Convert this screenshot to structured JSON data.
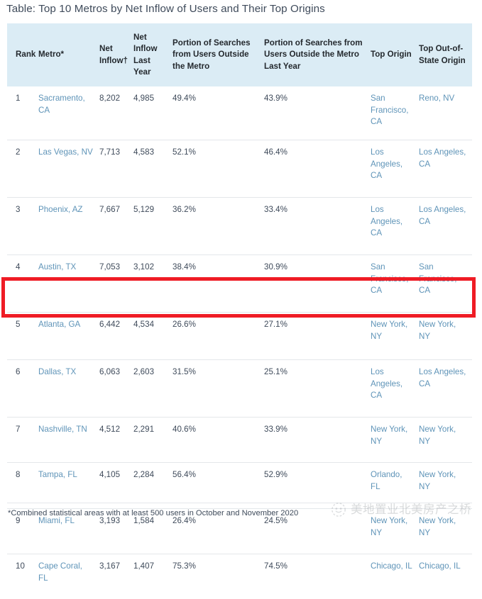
{
  "title": "Table: Top 10 Metros by Net Inflow of Users and Their Top Origins",
  "colors": {
    "header_background": "#dbecf5",
    "link_text": "#5f94b8",
    "body_text": "#3f4b5b",
    "highlight_border": "#ef1c25",
    "row_divider": "#e4e7ea"
  },
  "table": {
    "headers": {
      "rank": "Rank",
      "metro": "Metro*",
      "net_inflow": "Net Inflow†",
      "net_inflow_last_year": "Net Inflow Last Year",
      "portion_outside": "Portion of Searches from Users Outside the Metro",
      "portion_outside_last_year": "Portion of Searches from Users Outside the Metro Last Year",
      "top_origin": "Top Origin",
      "top_out_of_state_origin": "Top Out-of-State Origin"
    },
    "rows": [
      {
        "rank": "1",
        "metro": "Sacramento, CA",
        "net_inflow": "8,202",
        "net_inflow_last_year": "4,985",
        "portion_outside": "49.4%",
        "portion_outside_last_year": "43.9%",
        "top_origin": "San Francisco, CA",
        "top_out_of_state_origin": "Reno, NV"
      },
      {
        "rank": "2",
        "metro": "Las Vegas, NV",
        "net_inflow": "7,713",
        "net_inflow_last_year": "4,583",
        "portion_outside": "52.1%",
        "portion_outside_last_year": "46.4%",
        "top_origin": "Los Angeles, CA",
        "top_out_of_state_origin": "Los Angeles, CA"
      },
      {
        "rank": "3",
        "metro": "Phoenix, AZ",
        "net_inflow": "7,667",
        "net_inflow_last_year": "5,129",
        "portion_outside": "36.2%",
        "portion_outside_last_year": "33.4%",
        "top_origin": "Los Angeles, CA",
        "top_out_of_state_origin": "Los Angeles, CA"
      },
      {
        "rank": "4",
        "metro": "Austin, TX",
        "net_inflow": "7,053",
        "net_inflow_last_year": "3,102",
        "portion_outside": "38.4%",
        "portion_outside_last_year": "30.9%",
        "top_origin": "San Francisco, CA",
        "top_out_of_state_origin": "San Francisco, CA"
      },
      {
        "rank": "5",
        "metro": "Atlanta, GA",
        "net_inflow": "6,442",
        "net_inflow_last_year": "4,534",
        "portion_outside": "26.6%",
        "portion_outside_last_year": "27.1%",
        "top_origin": "New York, NY",
        "top_out_of_state_origin": "New York, NY"
      },
      {
        "rank": "6",
        "metro": "Dallas, TX",
        "net_inflow": "6,063",
        "net_inflow_last_year": "2,603",
        "portion_outside": "31.5%",
        "portion_outside_last_year": "25.1%",
        "top_origin": "Los Angeles, CA",
        "top_out_of_state_origin": "Los Angeles, CA"
      },
      {
        "rank": "7",
        "metro": "Nashville, TN",
        "net_inflow": "4,512",
        "net_inflow_last_year": "2,291",
        "portion_outside": "40.6%",
        "portion_outside_last_year": "33.9%",
        "top_origin": "New York, NY",
        "top_out_of_state_origin": "New York, NY"
      },
      {
        "rank": "8",
        "metro": "Tampa, FL",
        "net_inflow": "4,105",
        "net_inflow_last_year": "2,284",
        "portion_outside": "56.4%",
        "portion_outside_last_year": "52.9%",
        "top_origin": "Orlando, FL",
        "top_out_of_state_origin": "New York, NY"
      },
      {
        "rank": "9",
        "metro": "Miami, FL",
        "net_inflow": "3,193",
        "net_inflow_last_year": "1,584",
        "portion_outside": "26.4%",
        "portion_outside_last_year": "24.5%",
        "top_origin": "New York, NY",
        "top_out_of_state_origin": "New York, NY"
      },
      {
        "rank": "10",
        "metro": "Cape Coral, FL",
        "net_inflow": "3,167",
        "net_inflow_last_year": "1,407",
        "portion_outside": "75.3%",
        "portion_outside_last_year": "74.5%",
        "top_origin": "Chicago, IL",
        "top_out_of_state_origin": "Chicago, IL"
      }
    ]
  },
  "highlight": {
    "highlighted_rank": "5",
    "highlighted_metro": "Atlanta, GA"
  },
  "footnote": "*Combined statistical areas with at least 500 users in October and November 2020",
  "watermark": {
    "text": "美地置业北美房产之桥",
    "logo_icon": "circular-logo-icon"
  }
}
